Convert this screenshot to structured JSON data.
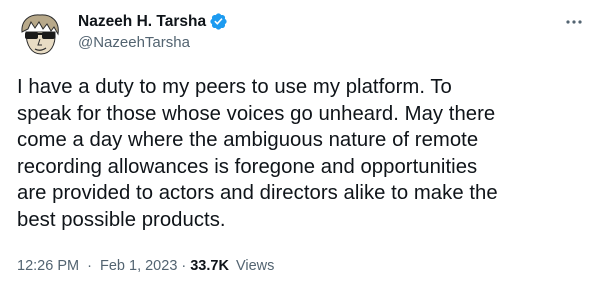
{
  "author": {
    "display_name": "Nazeeh H. Tarsha",
    "handle": "@NazeehTarsha",
    "verified": true
  },
  "tweet": {
    "text": "I have a duty to my peers to use my platform. To\nspeak for those whose voices go unheard. May there\ncome a day where the ambiguous nature of remote\nrecording allowances is foregone and opportunities\nare provided to actors and directors alike to make the\nbest possible products.",
    "time": "12:26 PM",
    "separator": "·",
    "date": "Feb 1, 2023",
    "views_count": "33.7K",
    "views_label": "Views"
  },
  "colors": {
    "text": "#0f1419",
    "secondary": "#536471",
    "verified": "#1d9bf0"
  },
  "icons": {
    "verified": "verified-badge-icon",
    "more": "more-options-icon"
  }
}
